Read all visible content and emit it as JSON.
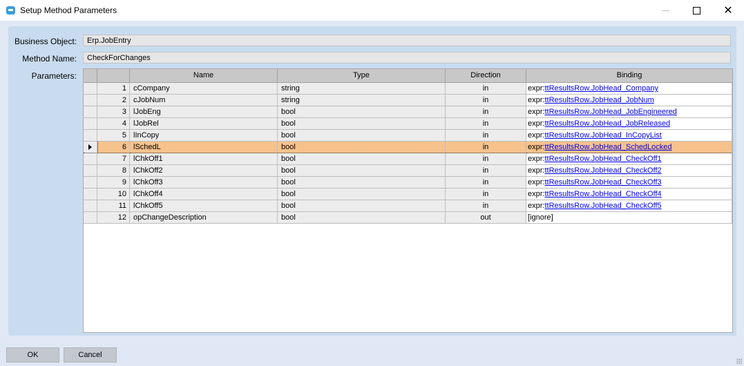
{
  "window": {
    "title": "Setup Method Parameters",
    "controls": {
      "minimize": "minimize-icon",
      "maximize": "maximize-icon",
      "close": "close-icon"
    }
  },
  "form": {
    "business_object_label": "Business Object:",
    "business_object_value": "Erp.JobEntry",
    "method_name_label": "Method Name:",
    "method_name_value": "CheckForChanges",
    "parameters_label": "Parameters:"
  },
  "grid": {
    "columns": [
      "Name",
      "Type",
      "Direction",
      "Binding"
    ],
    "selected_row": 6,
    "rows": [
      {
        "num": "1",
        "name": "cCompany",
        "type": "string",
        "direction": "in",
        "binding_prefix": "expr:",
        "binding_link": "ttResultsRow.JobHead_Company"
      },
      {
        "num": "2",
        "name": "cJobNum",
        "type": "string",
        "direction": "in",
        "binding_prefix": "expr:",
        "binding_link": "ttResultsRow.JobHead_JobNum"
      },
      {
        "num": "3",
        "name": "lJobEng",
        "type": "bool",
        "direction": "in",
        "binding_prefix": "expr:",
        "binding_link": "ttResultsRow.JobHead_JobEngineered"
      },
      {
        "num": "4",
        "name": "lJobRel",
        "type": "bool",
        "direction": "in",
        "binding_prefix": "expr:",
        "binding_link": "ttResultsRow.JobHead_JobReleased"
      },
      {
        "num": "5",
        "name": "lInCopy",
        "type": "bool",
        "direction": "in",
        "binding_prefix": "expr:",
        "binding_link": "ttResultsRow.JobHead_InCopyList"
      },
      {
        "num": "6",
        "name": "lSchedL",
        "type": "bool",
        "direction": "in",
        "binding_prefix": "expr:",
        "binding_link": "ttResultsRow.JobHead_SchedLocked"
      },
      {
        "num": "7",
        "name": "lChkOff1",
        "type": "bool",
        "direction": "in",
        "binding_prefix": "expr:",
        "binding_link": "ttResultsRow.JobHead_CheckOff1"
      },
      {
        "num": "8",
        "name": "lChkOff2",
        "type": "bool",
        "direction": "in",
        "binding_prefix": "expr:",
        "binding_link": "ttResultsRow.JobHead_CheckOff2"
      },
      {
        "num": "9",
        "name": "lChkOff3",
        "type": "bool",
        "direction": "in",
        "binding_prefix": "expr:",
        "binding_link": "ttResultsRow.JobHead_CheckOff3"
      },
      {
        "num": "10",
        "name": "lChkOff4",
        "type": "bool",
        "direction": "in",
        "binding_prefix": "expr:",
        "binding_link": "ttResultsRow.JobHead_CheckOff4"
      },
      {
        "num": "11",
        "name": "lChkOff5",
        "type": "bool",
        "direction": "in",
        "binding_prefix": "expr:",
        "binding_link": "ttResultsRow.JobHead_CheckOff5"
      },
      {
        "num": "12",
        "name": "opChangeDescription",
        "type": "bool",
        "direction": "out",
        "binding_prefix": "[ignore]",
        "binding_link": ""
      }
    ]
  },
  "buttons": {
    "ok": "OK",
    "cancel": "Cancel"
  },
  "colors": {
    "selected_row": "#f7c28c",
    "panel": "#c9dcef",
    "background": "#dfe8f4",
    "link": "#0000ee"
  }
}
